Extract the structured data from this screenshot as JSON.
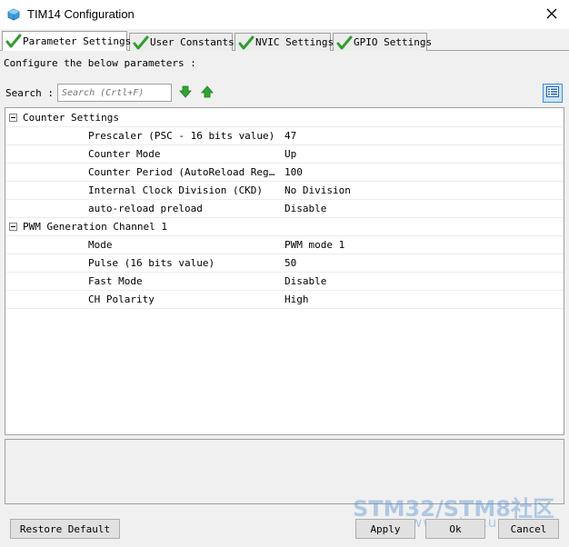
{
  "window": {
    "title": "TIM14 Configuration",
    "icon": "cube-icon",
    "close_icon": "close-icon"
  },
  "tabs": [
    {
      "label": "Parameter Settings",
      "active": true
    },
    {
      "label": "User Constants",
      "active": false
    },
    {
      "label": "NVIC Settings",
      "active": false
    },
    {
      "label": "GPIO Settings",
      "active": false
    }
  ],
  "configure_label": "Configure the below parameters :",
  "search": {
    "label": "Search :",
    "placeholder": "Search (Crtl+F)"
  },
  "groups": [
    {
      "label": "Counter Settings",
      "params": [
        {
          "name": "Prescaler (PSC - 16 bits value)",
          "value": "47"
        },
        {
          "name": "Counter Mode",
          "value": "Up"
        },
        {
          "name": "Counter Period (AutoReload Regis...",
          "value": "100"
        },
        {
          "name": "Internal Clock Division (CKD)",
          "value": "No Division"
        },
        {
          "name": "auto-reload preload",
          "value": "Disable"
        }
      ]
    },
    {
      "label": "PWM Generation Channel 1",
      "params": [
        {
          "name": "Mode",
          "value": "PWM mode 1"
        },
        {
          "name": "Pulse (16 bits value)",
          "value": "50"
        },
        {
          "name": "Fast Mode",
          "value": "Disable"
        },
        {
          "name": "CH Polarity",
          "value": "High"
        }
      ]
    }
  ],
  "buttons": {
    "restore_default": "Restore Default",
    "apply": "Apply",
    "ok": "Ok",
    "cancel": "Cancel"
  },
  "watermark": {
    "main": "STM32/STM8社区",
    "sub": "www.stmcu.org"
  },
  "colors": {
    "check_green": "#2e9e2e",
    "arrow_green": "#2fa52f",
    "view_button_blue": "#3a8ee6"
  }
}
